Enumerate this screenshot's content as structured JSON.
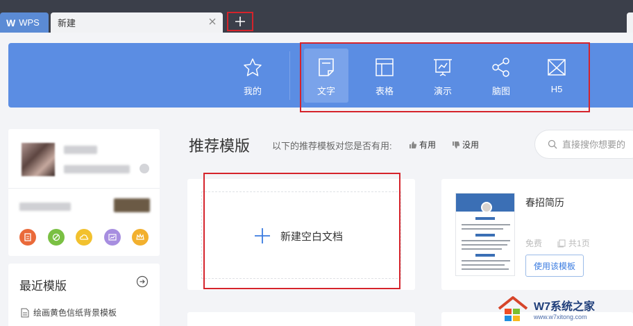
{
  "titlebar": {
    "app_tab_label": "WPS",
    "doc_tab_label": "新建"
  },
  "toolbar": {
    "items": [
      {
        "label": "我的",
        "icon": "star-icon"
      },
      {
        "label": "文字",
        "icon": "document-icon",
        "active": true
      },
      {
        "label": "表格",
        "icon": "table-icon"
      },
      {
        "label": "演示",
        "icon": "presentation-icon"
      },
      {
        "label": "脑图",
        "icon": "mindmap-icon"
      },
      {
        "label": "H5",
        "icon": "h5-icon"
      }
    ],
    "color": "#5b8de3",
    "active_color": "#7aa3ea"
  },
  "recent": {
    "title": "最近模版",
    "items": [
      "绘画黄色信纸背景模板"
    ]
  },
  "main": {
    "title": "推荐模版",
    "question": "以下的推荐模板对您是否有用:",
    "vote_yes": "有用",
    "vote_no": "没用",
    "search_placeholder": "直接搜你想要的",
    "blank_label": "新建空白文档"
  },
  "template_card": {
    "name": "春招简历",
    "price": "免费",
    "pages": "共1页",
    "use_button": "使用该模板"
  },
  "watermark": {
    "brand": "W7系统之家",
    "url": "www.w7xitong.com"
  },
  "annotation_color": "#d5232b"
}
